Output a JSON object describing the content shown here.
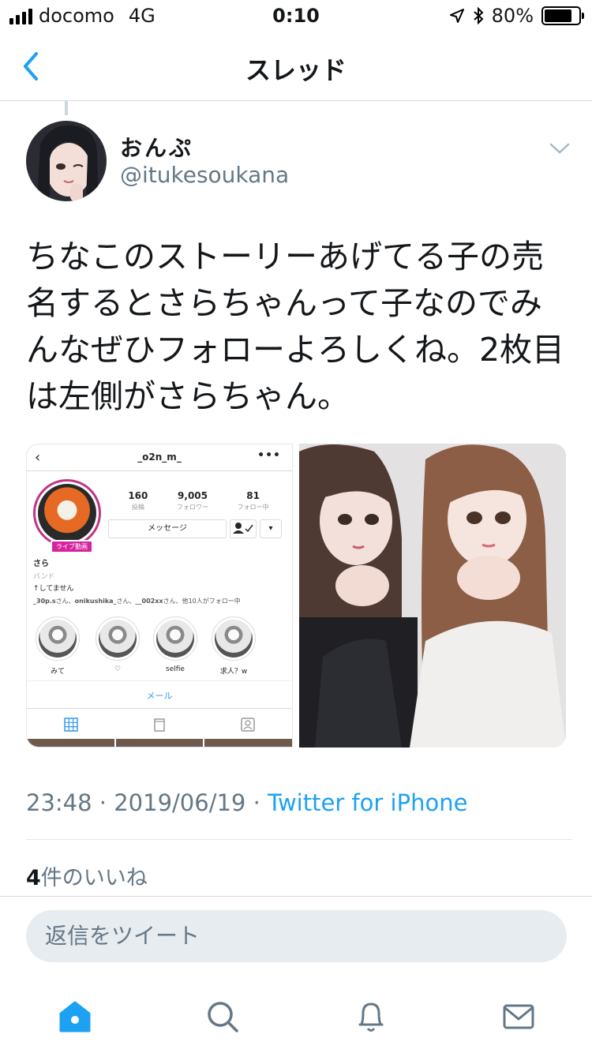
{
  "status_bar": {
    "carrier": "docomo",
    "network": "4G",
    "time": "0:10",
    "battery": "80%",
    "battery_level": 0.8
  },
  "nav": {
    "title": "スレッド"
  },
  "tweet": {
    "display_name": "おんぷ",
    "username": "@itukesoukana",
    "text": "ちなこのストーリーあげてる子の売名するとさらちゃんって子なのでみんなぜひフォローよろしくね。2枚目は左側がさらちゃん。",
    "time": "23:48",
    "date": "2019/06/19",
    "separator": "·",
    "source": "Twitter for iPhone",
    "likes_count": "4",
    "likes_label": "件のいいね"
  },
  "embedded_profile": {
    "username": "_o2n_m_",
    "more": "•••",
    "stats": [
      {
        "num": "160",
        "label": "投稿"
      },
      {
        "num": "9,005",
        "label": "フォロワー"
      },
      {
        "num": "81",
        "label": "フォロー中"
      }
    ],
    "message_button": "メッセージ",
    "live_badge": "ライブ動画",
    "name": "さら",
    "category": "バンド",
    "bio": "↑してません",
    "followed_by_users": [
      "_30p.s",
      "onikushika_",
      "__002xx"
    ],
    "followed_by_san": "さん、",
    "followed_by_rest": "他10人がフォロー中",
    "highlights": [
      "みて",
      "♡",
      "selfie",
      "求人？w"
    ],
    "mail_button": "メール"
  },
  "reply": {
    "placeholder": "返信をツイート"
  },
  "tab_bar": {
    "items": [
      "home-icon",
      "search-icon",
      "notifications-icon",
      "messages-icon"
    ]
  },
  "colors": {
    "accent": "#1da1f2",
    "secondary_text": "#657786",
    "reply_bg": "#e6ecf0"
  }
}
